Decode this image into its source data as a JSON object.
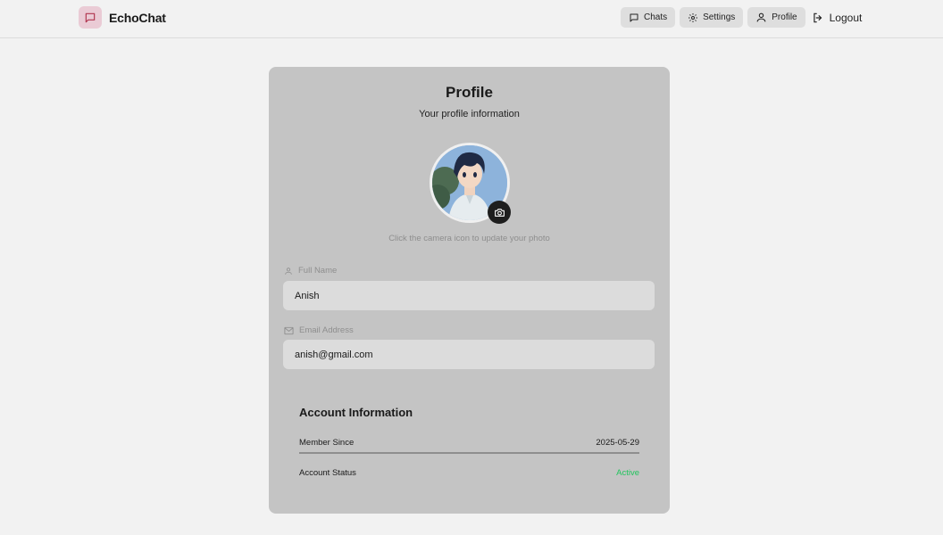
{
  "app": {
    "name": "EchoChat"
  },
  "nav": {
    "chats_label": "Chats",
    "settings_label": "Settings",
    "profile_label": "Profile",
    "logout_label": "Logout"
  },
  "profile": {
    "title": "Profile",
    "subtitle": "Your profile information",
    "photo_hint": "Click the camera icon to update your photo",
    "full_name_label": "Full Name",
    "full_name_value": "Anish",
    "email_label": "Email Address",
    "email_value": "anish@gmail.com"
  },
  "account": {
    "title": "Account Information",
    "member_since_label": "Member Since",
    "member_since_value": "2025-05-29",
    "status_label": "Account Status",
    "status_value": "Active"
  },
  "colors": {
    "page_bg": "#f2f2f2",
    "card_bg": "#c4c4c4",
    "brand_tint": "#eacbd5",
    "brand_accent": "#b0364f",
    "active_status": "#22c55e"
  },
  "icons": [
    "chat-bubble-icon",
    "gear-icon",
    "user-icon",
    "logout-icon",
    "camera-icon",
    "mail-icon"
  ]
}
